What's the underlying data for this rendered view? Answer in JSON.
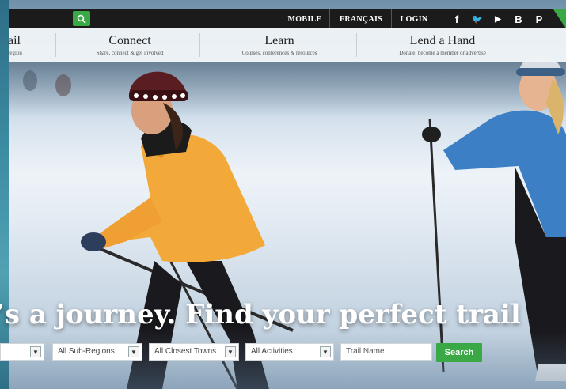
{
  "topbar": {
    "links": [
      "MOBILE",
      "FRANÇAIS",
      "LOGIN"
    ],
    "social_icons": [
      "facebook-icon",
      "twitter-icon",
      "youtube-icon",
      "blogger-icon",
      "pinterest-icon"
    ],
    "social_glyphs": [
      "f",
      "🐦",
      "▶",
      "B",
      "P"
    ],
    "search_icon": "search-icon"
  },
  "nav": {
    "partial": {
      "title": "ail",
      "subtitle": "region"
    },
    "items": [
      {
        "title": "Connect",
        "subtitle": "Share, connect & get involved"
      },
      {
        "title": "Learn",
        "subtitle": "Courses, conferences & resources"
      },
      {
        "title": "Lend a Hand",
        "subtitle": "Donate, become a member or advertise"
      }
    ]
  },
  "hero": {
    "headline": "’s a journey. Find your perfect trail"
  },
  "filters": {
    "selects": [
      "",
      "All Sub-Regions",
      "All Closest Towns",
      "All Activities"
    ],
    "dropdown_glyph": "▼",
    "trail_name_placeholder": "Trail Name",
    "search_label": "Search"
  },
  "colors": {
    "accent_green": "#3aa845",
    "topbar_bg": "#1b1b1b",
    "nav_bg": "#f0f4f7",
    "jacket_yellow": "#f2a93a",
    "jacket_blue": "#3d7fc4"
  }
}
